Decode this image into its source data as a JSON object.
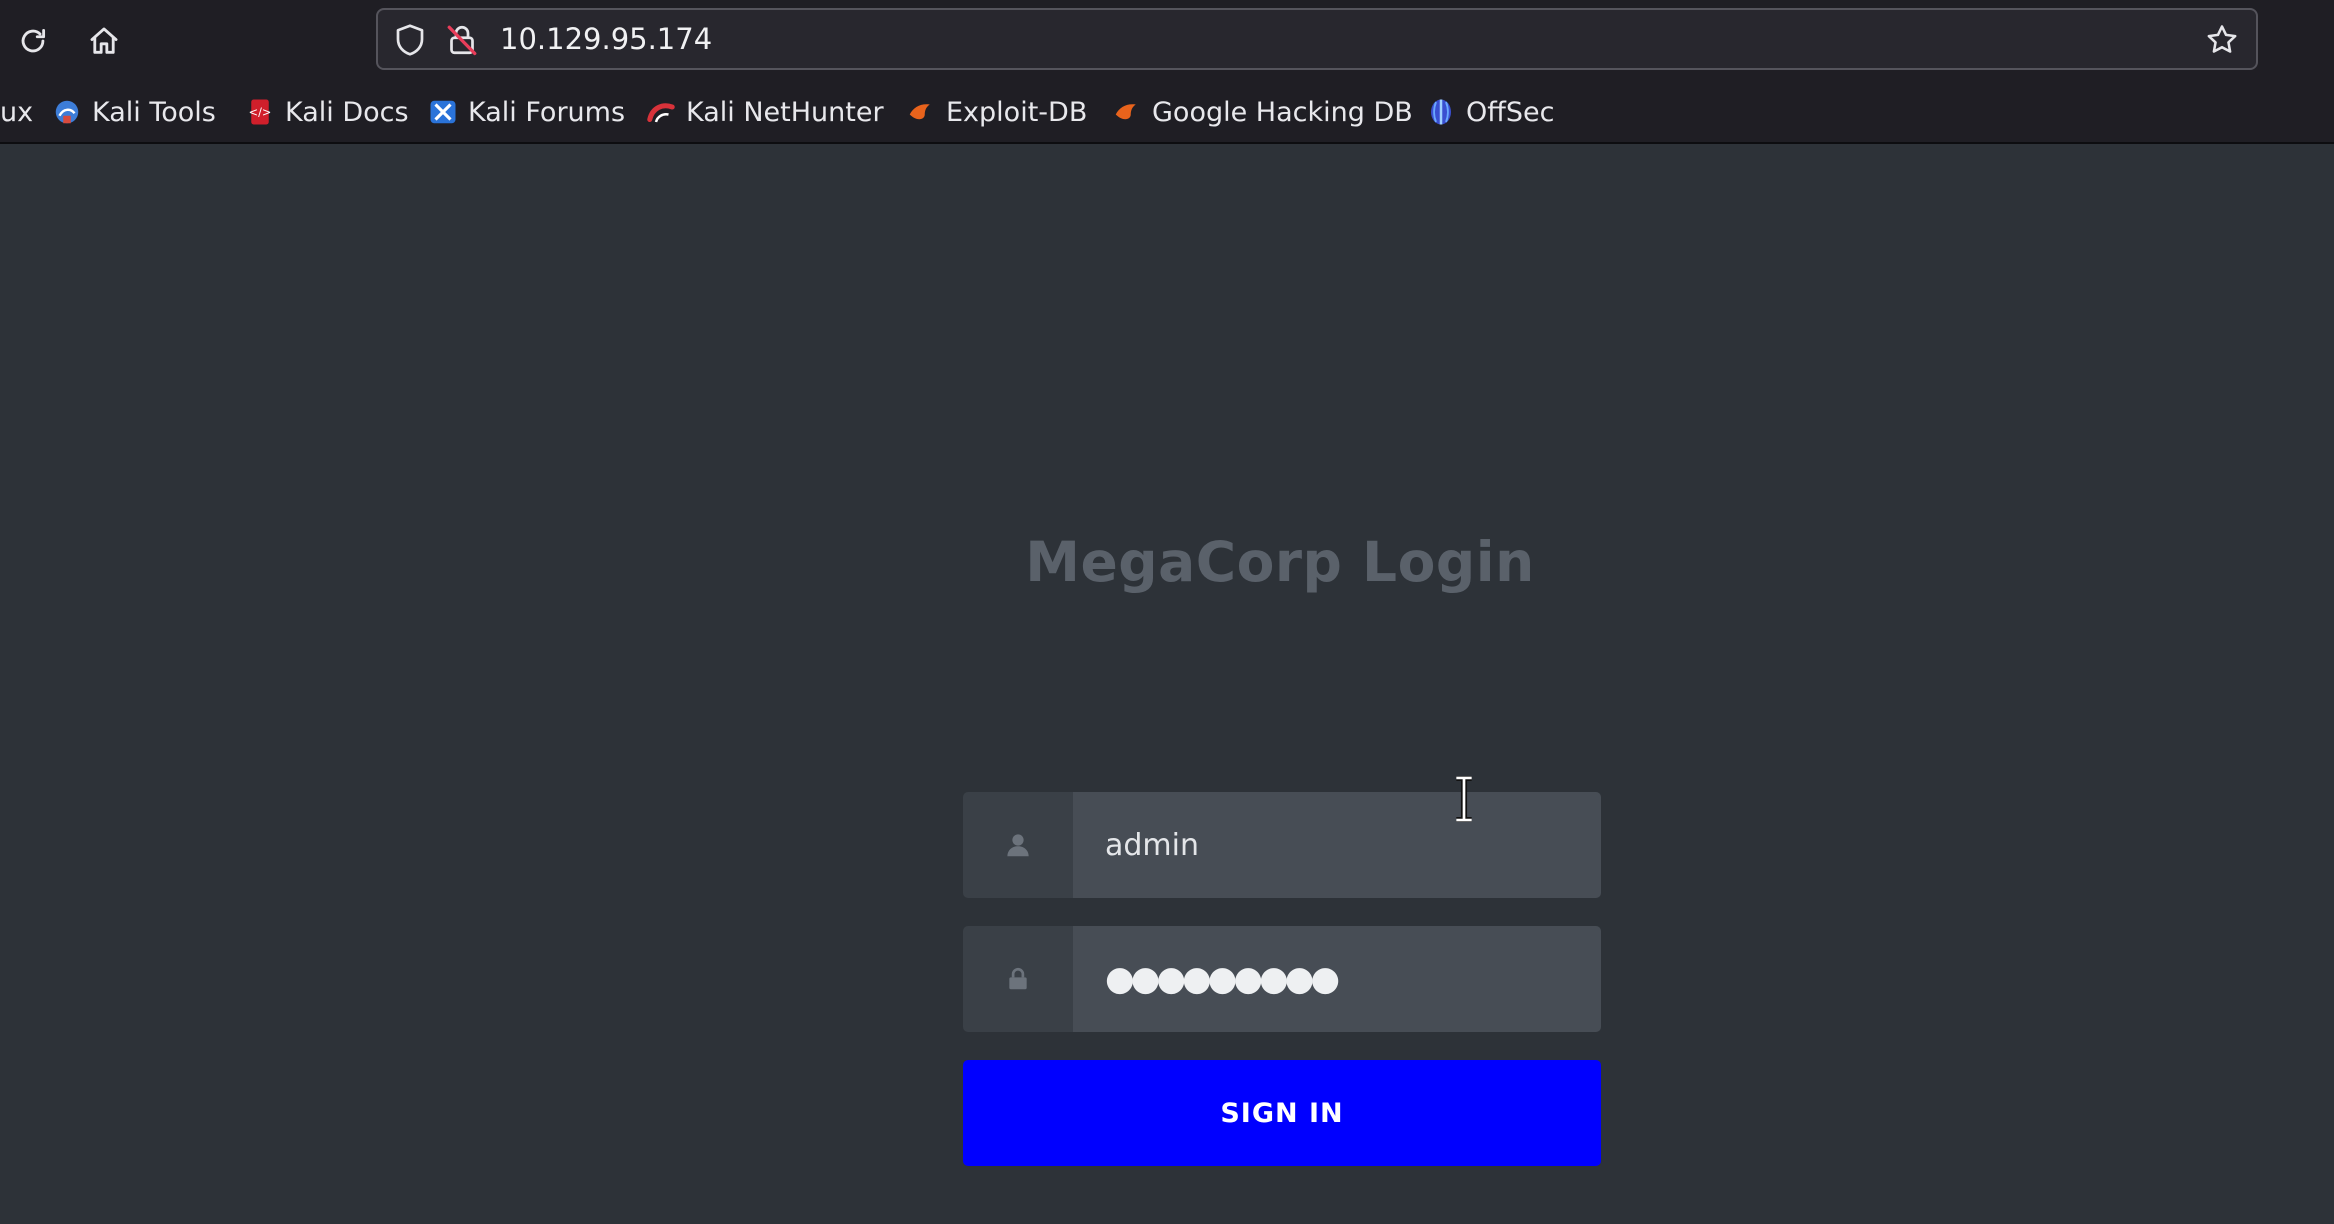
{
  "browser": {
    "url": "10.129.95.174",
    "bookmarks": [
      {
        "label": "ux",
        "icon": "none"
      },
      {
        "label": "Kali Tools",
        "icon": "kali-tools-icon"
      },
      {
        "label": "Kali Docs",
        "icon": "kali-docs-icon"
      },
      {
        "label": "Kali Forums",
        "icon": "kali-forums-icon"
      },
      {
        "label": "Kali NetHunter",
        "icon": "kali-nethunter-icon"
      },
      {
        "label": "Exploit-DB",
        "icon": "exploit-db-icon"
      },
      {
        "label": "Google Hacking DB",
        "icon": "ghdb-icon"
      },
      {
        "label": "OffSec",
        "icon": "offsec-icon"
      }
    ]
  },
  "login": {
    "title": "MegaCorp Login",
    "username_value": "admin",
    "password_masked": "●●●●●●●●●",
    "submit_label": "SIGN IN"
  },
  "colors": {
    "page_bg": "#2d3238",
    "button_bg": "#0000ff",
    "title_color": "#5a616a"
  }
}
